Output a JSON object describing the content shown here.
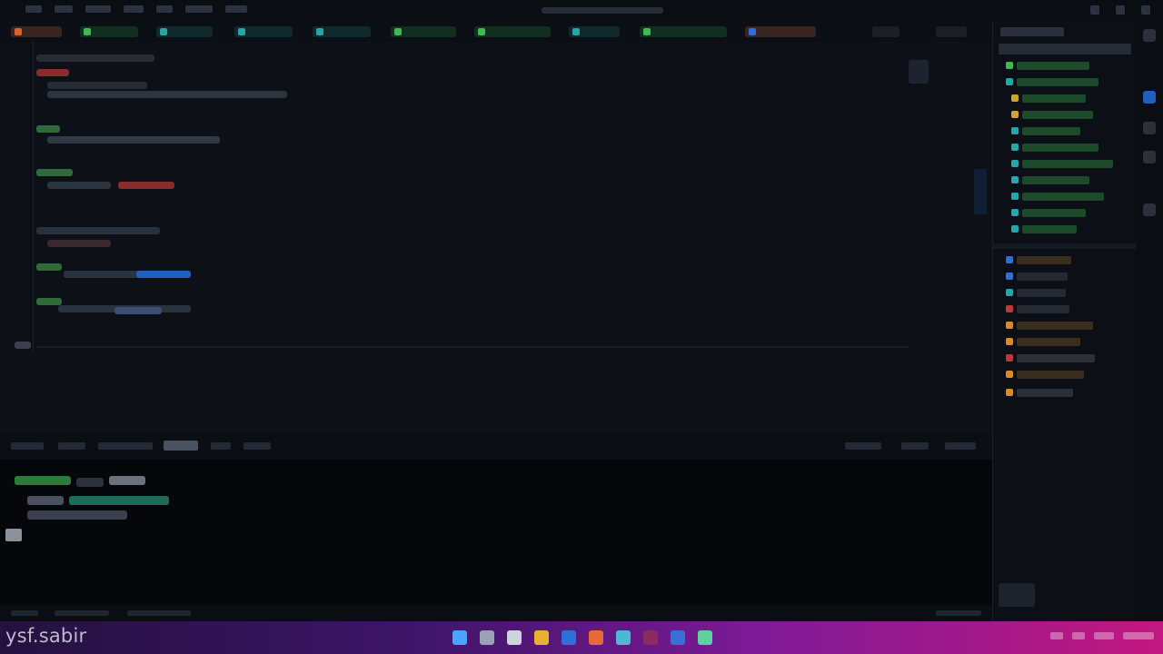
{
  "watermark": "ysf.sabir",
  "colors": {
    "editor_bg": "#0d1117",
    "terminal_bg": "#05070a",
    "accent_green": "#3fb950",
    "accent_red": "#c0392b",
    "accent_blue": "#1f6feb",
    "accent_orange": "#d98b2b",
    "taskbar_gradient": [
      "#24113f",
      "#7d1a96",
      "#c2187f"
    ]
  },
  "icons": {
    "editor_tabs": "file-tab-icon",
    "taskbar": [
      "windows-start-icon",
      "search-icon",
      "task-view-icon",
      "file-explorer-icon",
      "browser-icon",
      "terminal-icon",
      "store-icon",
      "settings-icon",
      "vscode-icon",
      "edge-icon"
    ],
    "activity_bar": [
      "account-icon",
      "settings-gear-icon",
      "search-icon",
      "source-control-icon",
      "extensions-icon"
    ]
  }
}
